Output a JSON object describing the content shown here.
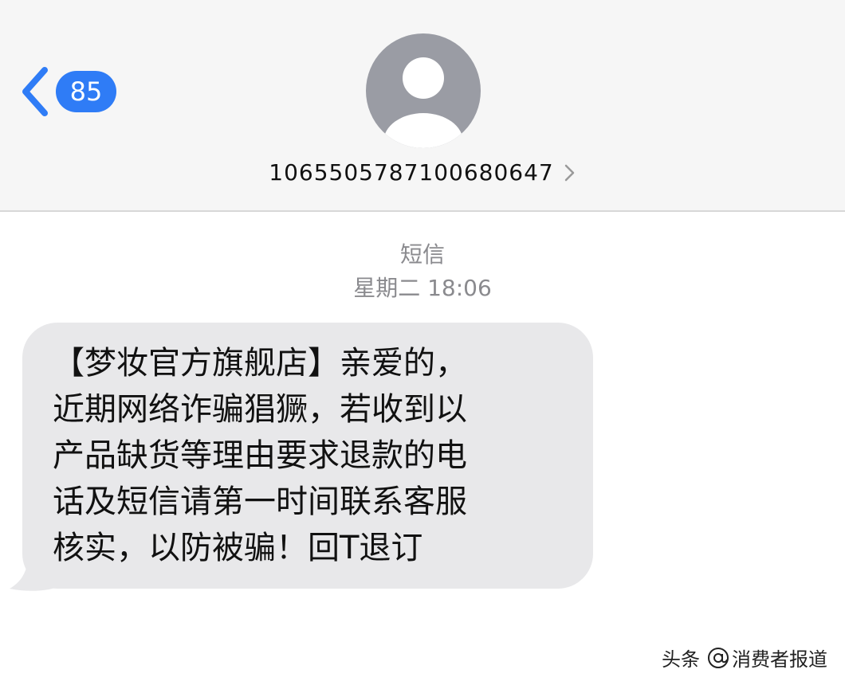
{
  "header": {
    "back_badge_count": "85",
    "contact_number": "10655057871006806 47",
    "contact_number_clean": "106550578710068064 7"
  },
  "contact": {
    "number": "1065505787100680647"
  },
  "meta": {
    "service": "短信",
    "timestamp": "星期二 18:06"
  },
  "message": {
    "text": "【梦妆官方旗舰店】亲爱的，\n近期网络诈骗猖獗，若收到以\n产品缺货等理由要求退款的电\n话及短信请第一时间联系客服\n核实，以防被骗！回T退订"
  },
  "watermark": {
    "prefix": "头条",
    "handle": "消费者报道"
  },
  "colors": {
    "header_bg": "#f6f6f6",
    "accent": "#2f7cf6",
    "bubble_bg": "#e8e8ea",
    "meta_text": "#8a8a8e",
    "avatar": "#9a9ca4"
  },
  "icons": {
    "back": "chevron-left-icon",
    "avatar": "person-silhouette-icon",
    "detail": "chevron-right-icon",
    "watermark_at": "at-sign-icon"
  }
}
